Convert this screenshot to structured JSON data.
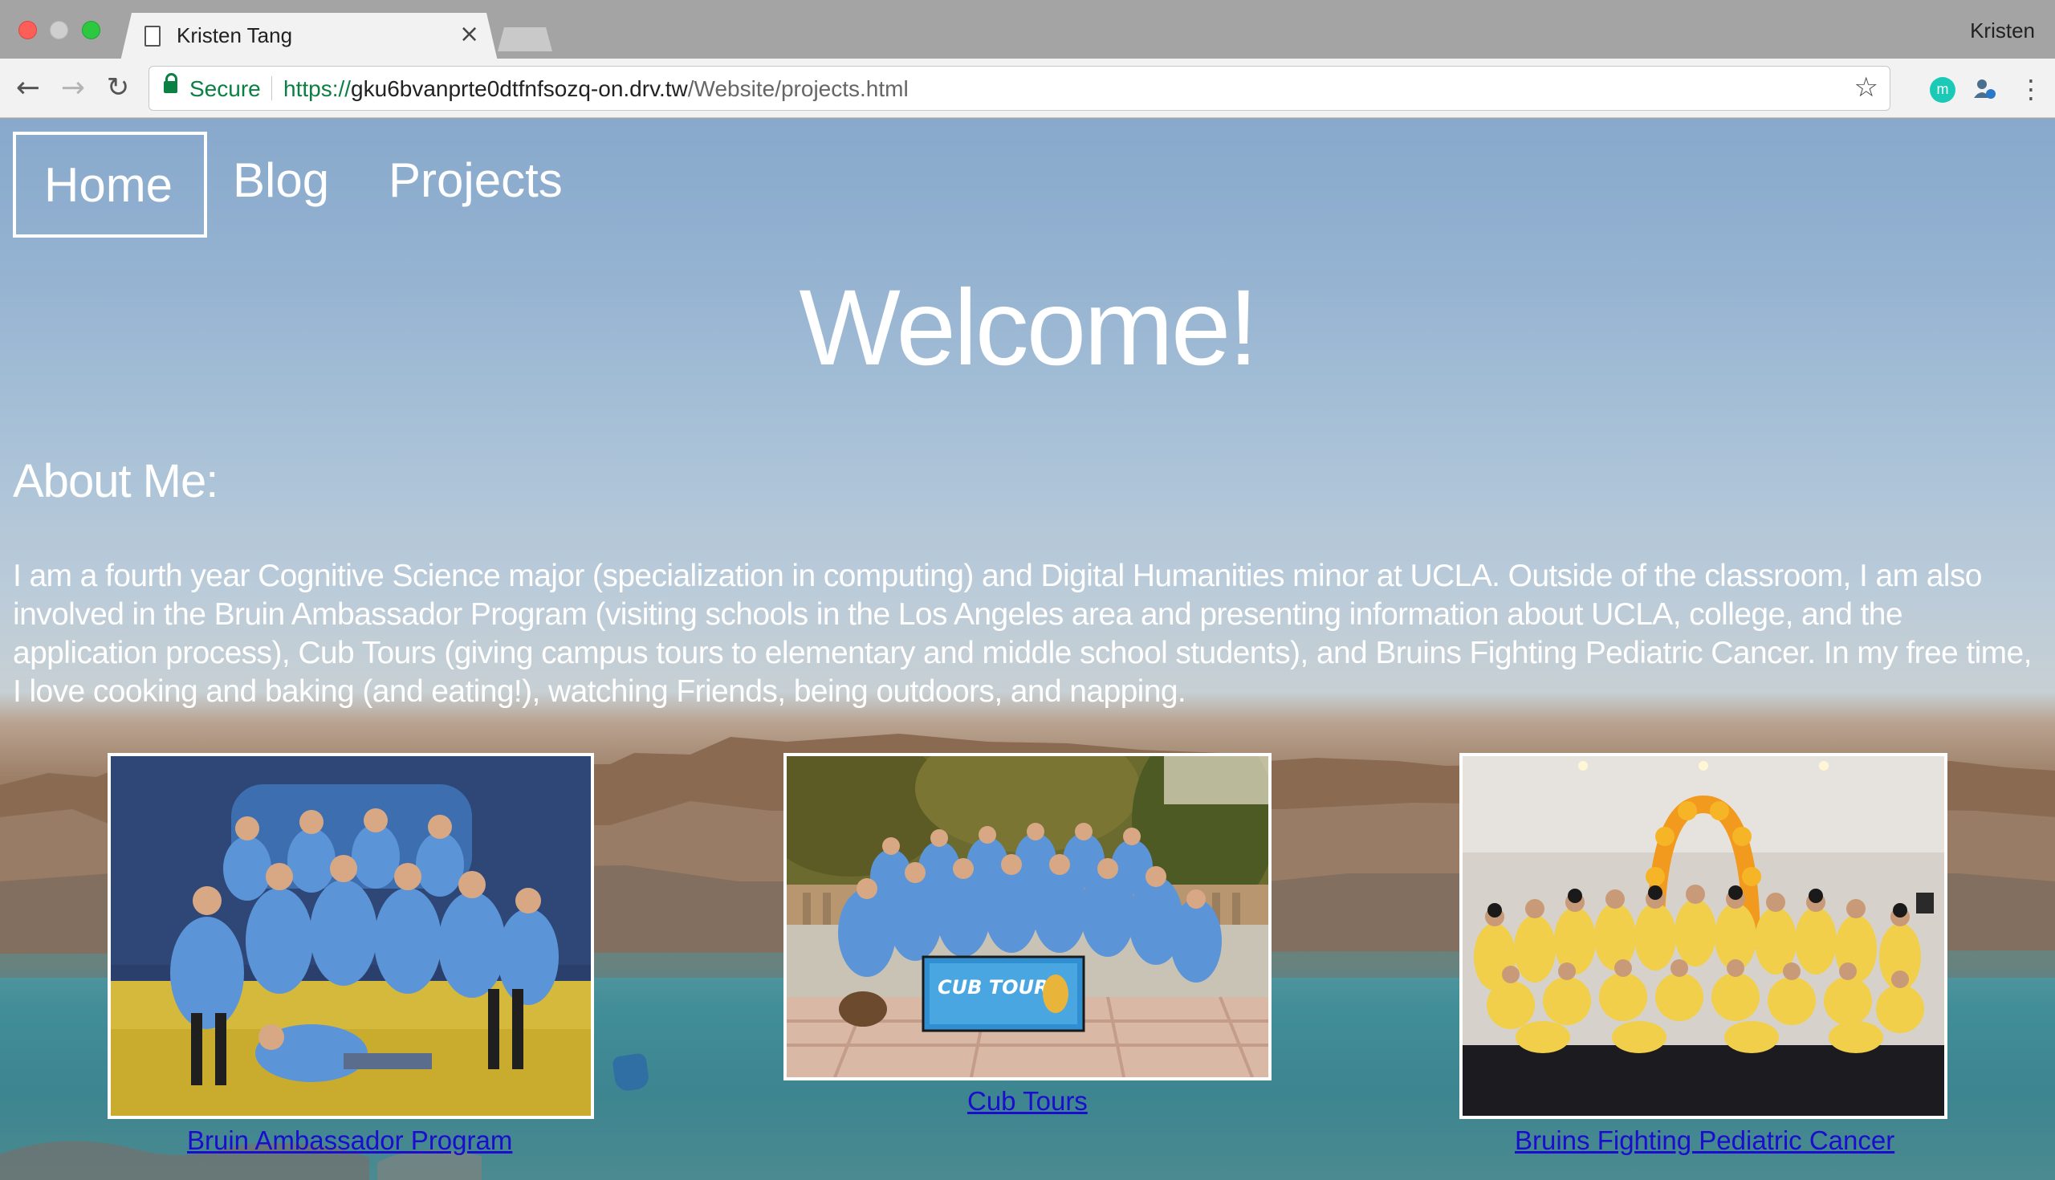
{
  "browser": {
    "tab_title": "Kristen Tang",
    "close_glyph": "×",
    "profile_name": "Kristen",
    "secure_label": "Secure",
    "url_scheme": "https://",
    "url_host": "gku6bvanprte0dtfnfsozq-on.drv.tw",
    "url_path": "/Website/projects.html",
    "extension_1_letter": "m",
    "icons": [
      "page-icon",
      "back-arrow-icon",
      "forward-arrow-icon",
      "reload-icon",
      "lock-icon",
      "star-icon",
      "menu-icon"
    ]
  },
  "nav": {
    "home": "Home",
    "blog": "Blog",
    "projects": "Projects"
  },
  "page": {
    "welcome": "Welcome!",
    "about_heading": "About Me:",
    "about_text": "I am a fourth year Cognitive Science major (specialization in computing) and Digital Humanities minor at UCLA. Outside of the classroom, I am also involved in the Bruin Ambassador Program (visiting schools in the Los Angeles area and presenting information about UCLA, college, and the application process), Cub Tours (giving campus tours to elementary and middle school students), and Bruins Fighting Pediatric Cancer. In my free time, I love cooking and baking (and eating!), watching Friends, being outdoors, and napping."
  },
  "projects": [
    {
      "caption": "Bruin Ambassador Program"
    },
    {
      "caption": "Cub Tours",
      "banner_text": "CUB TOURS"
    },
    {
      "caption": "Bruins Fighting Pediatric Cancer"
    }
  ],
  "colors": {
    "link": "#1a0dce",
    "secure_green": "#0b8043",
    "shirt_blue": "#5b95d8",
    "shirt_yellow": "#f1cf4a"
  }
}
